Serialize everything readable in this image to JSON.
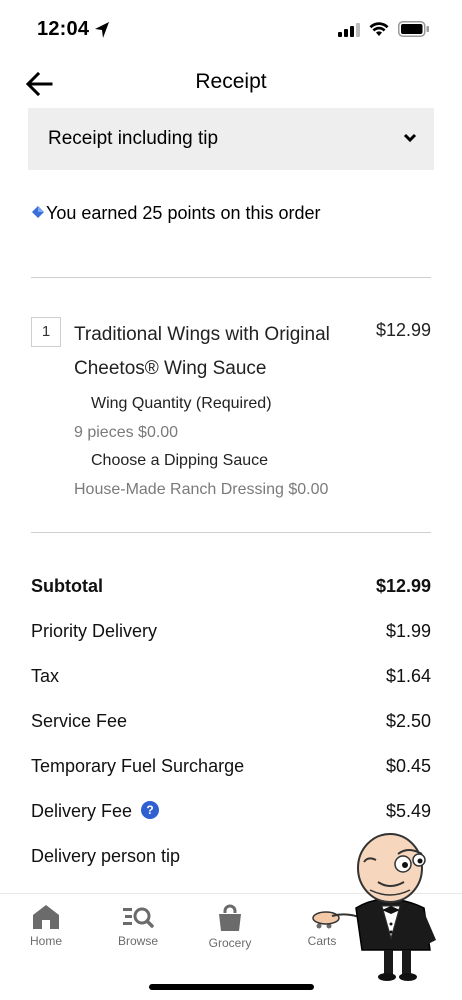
{
  "status_bar": {
    "time": "12:04"
  },
  "header": {
    "title": "Receipt"
  },
  "receipt_selector": {
    "selected": "Receipt including tip"
  },
  "rewards": {
    "message": "You earned 25 points on this order"
  },
  "order_item": {
    "quantity": "1",
    "name": "Traditional Wings with Original Cheetos® Wing Sauce",
    "price": "$12.99",
    "modifiers": [
      {
        "title": "Wing Quantity (Required)",
        "value": "9 pieces $0.00"
      },
      {
        "title": "Choose a Dipping Sauce",
        "value": "House-Made Ranch Dressing $0.00"
      }
    ]
  },
  "summary": [
    {
      "label": "Subtotal",
      "value": "$12.99"
    },
    {
      "label": "Priority Delivery",
      "value": "$1.99"
    },
    {
      "label": "Tax",
      "value": "$1.64"
    },
    {
      "label": "Service Fee",
      "value": "$2.50"
    },
    {
      "label": "Temporary Fuel Surcharge",
      "value": "$0.45"
    },
    {
      "label": "Delivery Fee",
      "value": "$5.49"
    },
    {
      "label": "Delivery person tip",
      "value": ""
    }
  ],
  "tab_bar": {
    "tabs": [
      {
        "label": "Home",
        "icon": "home-icon"
      },
      {
        "label": "Browse",
        "icon": "browse-icon"
      },
      {
        "label": "Grocery",
        "icon": "grocery-bag-icon"
      },
      {
        "label": "Carts",
        "icon": "cart-icon"
      }
    ]
  },
  "colors": {
    "accent_blue": "#2f5fd0",
    "panel_gray": "#eeeeee",
    "muted_text": "#7a7a7a",
    "divider": "#cfcfcf"
  }
}
